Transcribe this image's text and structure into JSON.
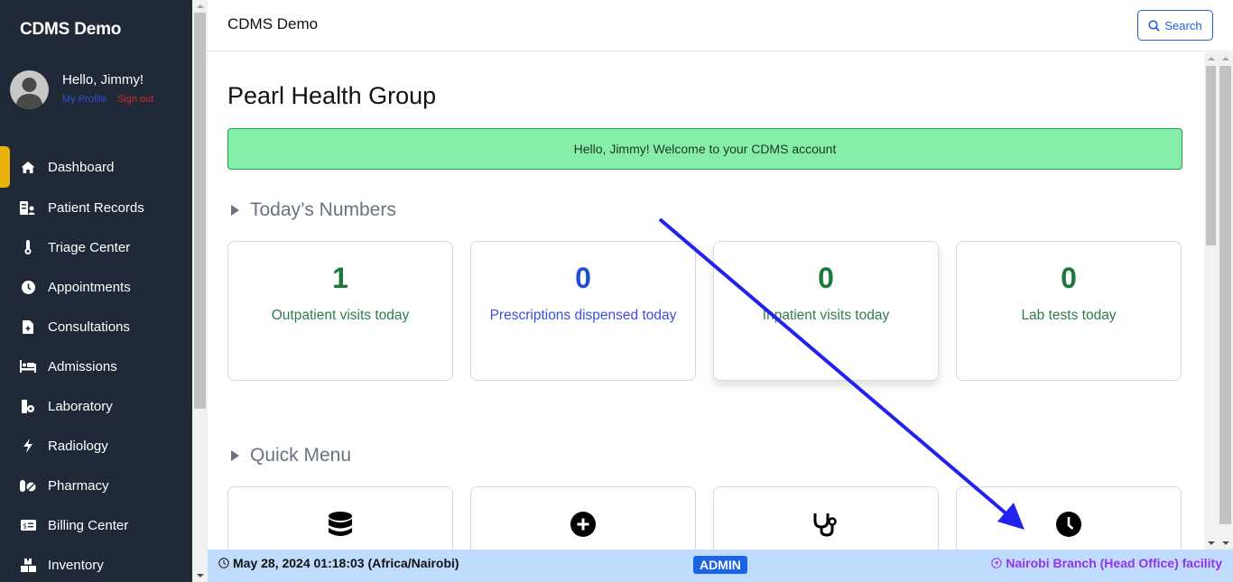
{
  "sidebar": {
    "brand": "CDMS Demo",
    "greeting": "Hello, Jimmy!",
    "my_profile": "My Profile",
    "sign_out": "Sign out",
    "items": [
      {
        "label": "Dashboard",
        "icon": "home-icon",
        "active": true
      },
      {
        "label": "Patient Records",
        "icon": "patient-records-icon"
      },
      {
        "label": "Triage Center",
        "icon": "thermometer-icon"
      },
      {
        "label": "Appointments",
        "icon": "clock-icon"
      },
      {
        "label": "Consultations",
        "icon": "file-medical-icon"
      },
      {
        "label": "Admissions",
        "icon": "bed-icon"
      },
      {
        "label": "Laboratory",
        "icon": "vial-gear-icon"
      },
      {
        "label": "Radiology",
        "icon": "bolt-icon"
      },
      {
        "label": "Pharmacy",
        "icon": "pills-icon"
      },
      {
        "label": "Billing Center",
        "icon": "money-bill-icon"
      },
      {
        "label": "Inventory",
        "icon": "boxes-icon"
      }
    ],
    "accent_color": "#e8b008"
  },
  "topbar": {
    "title": "CDMS Demo",
    "search_label": "Search"
  },
  "main": {
    "org_title": "Pearl Health Group",
    "welcome_message": "Hello, Jimmy! Welcome to your CDMS account",
    "todays_numbers": {
      "heading": "Today’s Numbers",
      "cards": [
        {
          "value": "1",
          "label": "Outpatient visits today",
          "color": "green"
        },
        {
          "value": "0",
          "label": "Prescriptions dispensed today",
          "color": "blue"
        },
        {
          "value": "0",
          "label": "Inpatient visits today",
          "color": "green"
        },
        {
          "value": "0",
          "label": "Lab tests today",
          "color": "green"
        }
      ]
    },
    "quick_menu": {
      "heading": "Quick Menu",
      "items": [
        {
          "icon": "database-icon"
        },
        {
          "icon": "plus-circle-icon"
        },
        {
          "icon": "stethoscope-icon"
        },
        {
          "icon": "clock-icon"
        }
      ]
    }
  },
  "footer": {
    "datetime": "May 28, 2024 01:18:03 (Africa/Nairobi)",
    "role_badge": "ADMIN",
    "facility": "Nairobi Branch (Head Office) facility"
  },
  "colors": {
    "sidebar_bg": "#1f2937",
    "welcome_bg": "#87eeaa",
    "footer_bg": "#bfdbfe",
    "primary": "#1d63e6",
    "facility_text": "#9333ea",
    "annotation_arrow": "#2222ee"
  }
}
